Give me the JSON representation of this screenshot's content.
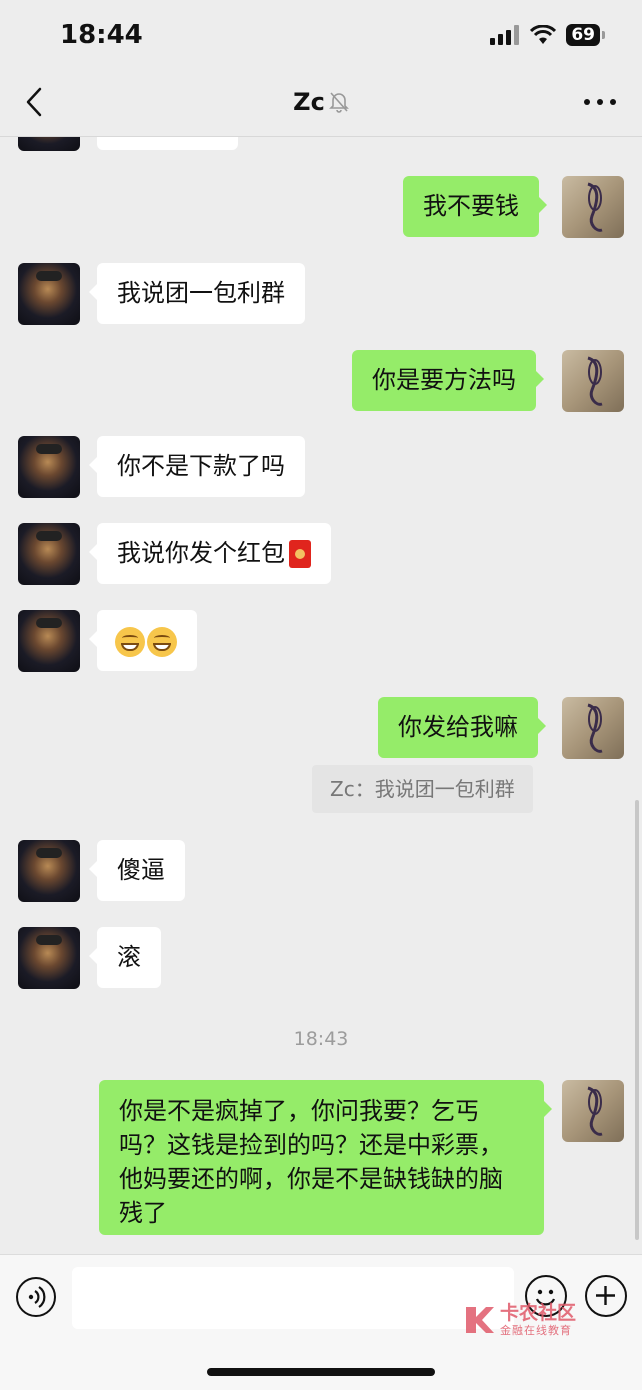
{
  "status_bar": {
    "time": "18:44",
    "battery": "69"
  },
  "nav": {
    "title": "Zc"
  },
  "messages": {
    "m1": "我不要钱",
    "m2": "我说团一包利群",
    "m3": "你是要方法吗",
    "m4": "你不是下款了吗",
    "m5": "我说你发个红包",
    "m7": "你发给我嘛",
    "quote": "Zc：我说团一包利群",
    "m8": "傻逼",
    "m9": "滚",
    "m10": "你是不是疯掉了，你问我要？乞丐吗？这钱是捡到的吗？还是中彩票，他妈要还的啊，你是不是缺钱缺的脑残了"
  },
  "timestamp": "18:43",
  "input": {
    "placeholder": ""
  },
  "watermark": {
    "title": "卡农社区",
    "subtitle": "金融在线教育"
  },
  "colors": {
    "bg": "#ededed",
    "sent_bubble": "#95ec69",
    "recv_bubble": "#ffffff"
  },
  "icons": {
    "back": "chevron-left-icon",
    "mute": "bell-slash-icon",
    "more": "more-dots-icon",
    "voice": "voice-icon",
    "emoji": "smile-icon",
    "plus": "plus-icon"
  }
}
